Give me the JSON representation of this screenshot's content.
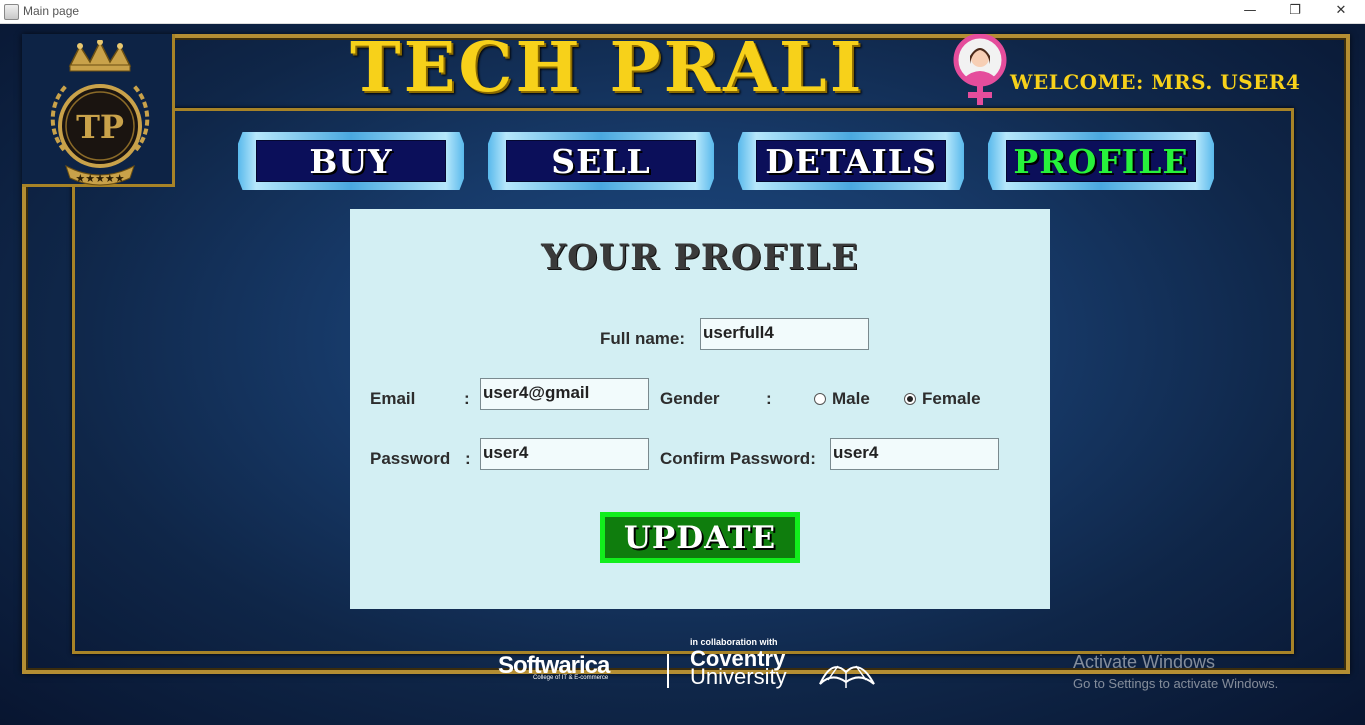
{
  "window": {
    "title": "Main page",
    "controls": [
      "—",
      "❐",
      "✕"
    ]
  },
  "header": {
    "logo_text": "TP",
    "brand": "TECH PRALI",
    "welcome": "WELCOME:  MRS. USER4"
  },
  "nav": {
    "items": [
      {
        "label": "BUY"
      },
      {
        "label": "SELL"
      },
      {
        "label": "DETAILS"
      },
      {
        "label": "PROFILE",
        "active": true
      }
    ]
  },
  "profile": {
    "title": "YOUR PROFILE",
    "full_name_label": "Full name:",
    "full_name_value": "userfull4",
    "email_label": "Email",
    "email_colon": ":",
    "email_value": "user4@gmail",
    "gender_label": "Gender",
    "gender_colon": ":",
    "gender_options": [
      "Male",
      "Female"
    ],
    "gender_selected": "Female",
    "password_label": "Password",
    "password_colon": ":",
    "password_value": "user4",
    "confirm_label": "Confirm Password:",
    "confirm_value": "user4",
    "update_label": "UPDATE"
  },
  "footer": {
    "collab": "in collaboration with",
    "softwarica": "Softwarica",
    "softwarica_sub": "College of IT & E-commerce",
    "coventry_1": "Coventry",
    "coventry_2": "University"
  },
  "watermark": {
    "line1": "Activate Windows",
    "line2": "Go to Settings to activate Windows."
  },
  "colors": {
    "gold": "#f7d11a",
    "nav_active": "#27f23b",
    "panel": "#d3eff3",
    "update_border": "#12ee1c",
    "update_fill": "#0f7d0d"
  }
}
